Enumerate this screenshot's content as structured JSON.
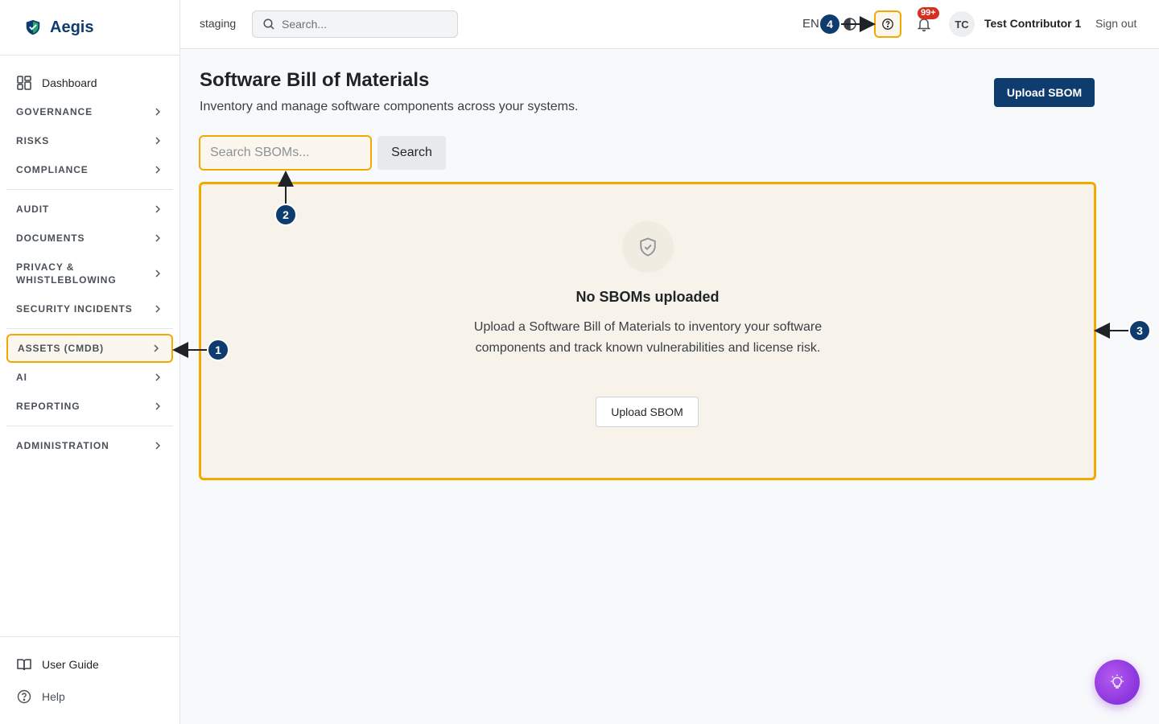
{
  "brand": {
    "name": "Aegis"
  },
  "sidebar": {
    "dashboard": "Dashboard",
    "groups": [
      [
        "Governance",
        "Risks",
        "Compliance"
      ],
      [
        "Audit",
        "Documents",
        "Privacy & Whistleblowing",
        "Security Incidents"
      ],
      [
        "Assets (CMDB)",
        "AI",
        "Reporting"
      ],
      [
        "Administration"
      ]
    ],
    "active": "Assets (CMDB)",
    "footer": {
      "user_guide": "User Guide",
      "help": "Help"
    }
  },
  "header": {
    "environment": "staging",
    "search_placeholder": "Search...",
    "language": "EN",
    "notifications_badge": "99+",
    "avatar_initials": "TC",
    "user_name": "Test Contributor 1",
    "sign_out": "Sign out"
  },
  "main": {
    "title": "Software Bill of Materials",
    "subtitle": "Inventory and manage software components across your systems.",
    "upload_button": "Upload SBOM",
    "search_placeholder": "Search SBOMs...",
    "search_button": "Search",
    "empty_state": {
      "title": "No SBOMs uploaded",
      "description": "Upload a Software Bill of Materials to inventory your software components and track known vulnerabilities and license risk.",
      "button": "Upload SBOM"
    }
  },
  "annotations": [
    "1",
    "2",
    "3",
    "4"
  ],
  "colors": {
    "brand": "#0f3c6e",
    "highlight": "#f2a900",
    "badge": "#d92d20",
    "assistant": "#7a22d6"
  }
}
